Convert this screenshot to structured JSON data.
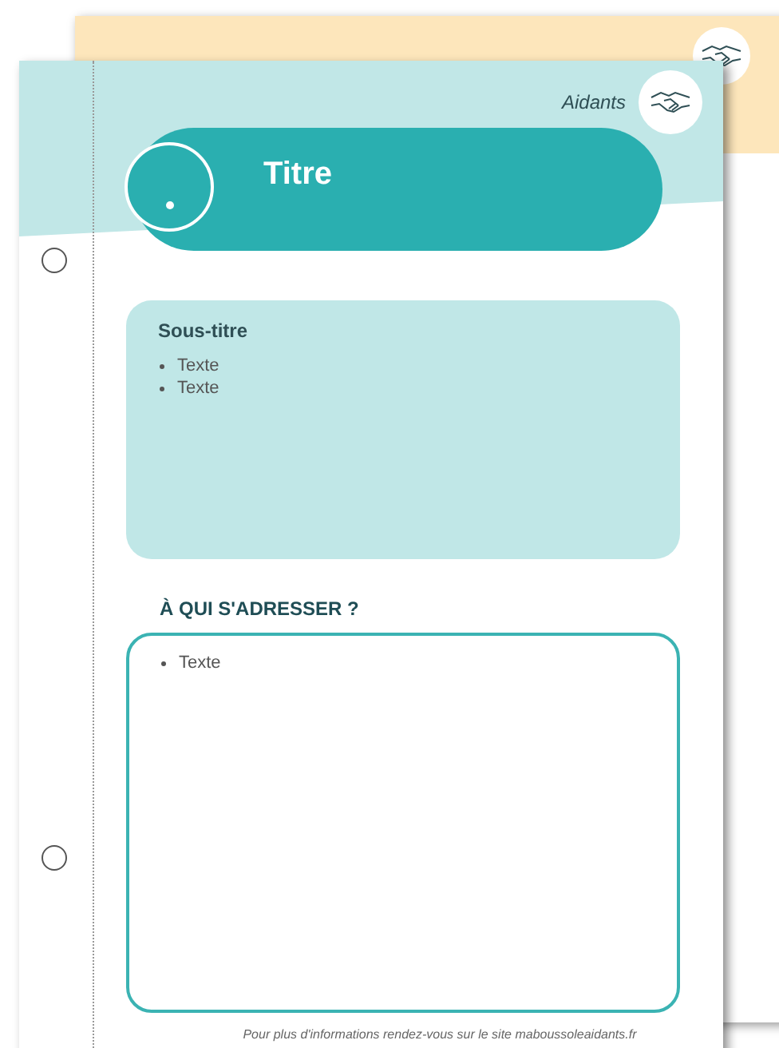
{
  "page": {
    "category": "Aidants",
    "title": "Titre"
  },
  "section": {
    "subtitle": "Sous-titre",
    "items": [
      "Texte",
      "Texte"
    ]
  },
  "contacts": {
    "heading": "À QUI S'ADRESSER ?",
    "items": [
      "Texte"
    ]
  },
  "footer": "Pour plus d'informations rendez-vous sur le site maboussoleaidants.fr"
}
